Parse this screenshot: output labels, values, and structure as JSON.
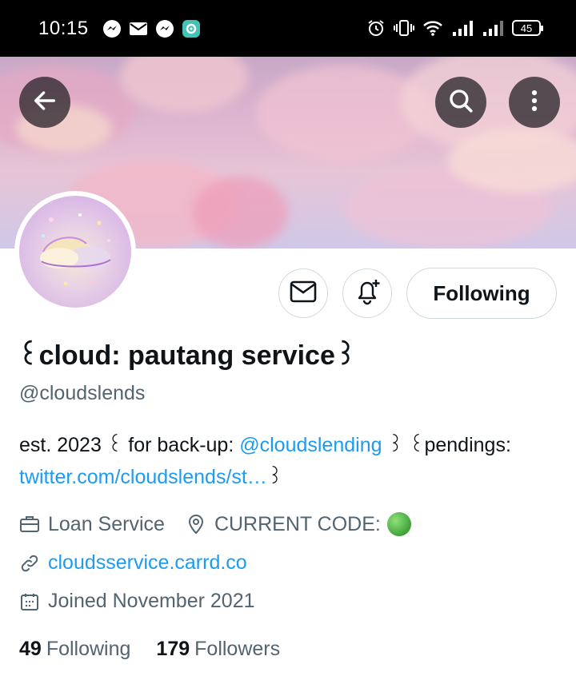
{
  "status_bar": {
    "time": "10:15",
    "notification_icons": [
      "messenger-icon",
      "mail-icon",
      "messenger-icon",
      "app-icon"
    ],
    "battery": "45",
    "status_icons": [
      "alarm-icon",
      "vibrate-icon",
      "wifi-icon",
      "signal-icon",
      "signal-icon"
    ]
  },
  "header": {
    "back": "back-arrow-icon",
    "search": "search-icon",
    "more": "more-vertical-icon"
  },
  "actions": {
    "message": "mail-icon",
    "notify": "bell-plus-icon",
    "follow_label": "Following"
  },
  "profile": {
    "name": "꒰cloud: pautang service꒱",
    "handle": "@cloudslends",
    "bio_prefix": "est. 2023 ꒰ for back-up: ",
    "bio_mention": "@cloudslending",
    "bio_mid": " ꒱ ꒰pendings: ",
    "bio_link": "twitter.com/cloudslends/st…",
    "bio_suffix": "꒱",
    "category": "Loan Service",
    "location": "CURRENT CODE:",
    "website": "cloudsservice.carrd.co",
    "joined": "Joined November 2021"
  },
  "stats": {
    "following_count": "49",
    "following_label": "Following",
    "followers_count": "179",
    "followers_label": "Followers"
  },
  "colors": {
    "accent_link": "#1d9bf0",
    "secondary_text": "#536471",
    "primary_text": "#0f1419",
    "border": "#cfd9de"
  }
}
